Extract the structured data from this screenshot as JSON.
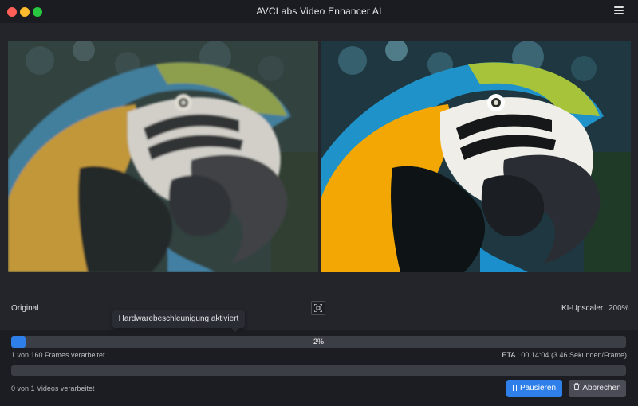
{
  "app": {
    "title": "AVCLabs Video Enhancer AI"
  },
  "preview": {
    "left_label": "Original",
    "right_label": "KI-Upscaler",
    "scale": "200%"
  },
  "tooltip": {
    "text": "Hardwarebeschleunigung aktiviert"
  },
  "progress": {
    "percent_text": "2%",
    "fraction": 0.02,
    "frames_text": "1 von 160 Frames verarbeitet",
    "eta_label": "ETA :",
    "eta_value": "00:14:04 (3.46 Sekunden/Frame)",
    "videos_text": "0 von 1 Videos verarbeitet"
  },
  "buttons": {
    "pause": "Pausieren",
    "cancel": "Abbrechen"
  },
  "icons": {
    "close": "close-window-dot",
    "minimize": "minimize-window-dot",
    "maximize": "maximize-window-dot",
    "menu": "hamburger-menu-icon",
    "compare": "compare-view-icon",
    "pause": "pause-icon",
    "trash": "trash-icon"
  },
  "colors": {
    "accent": "#2f7fea",
    "background": "#23252b",
    "panel": "#1c1d22"
  }
}
